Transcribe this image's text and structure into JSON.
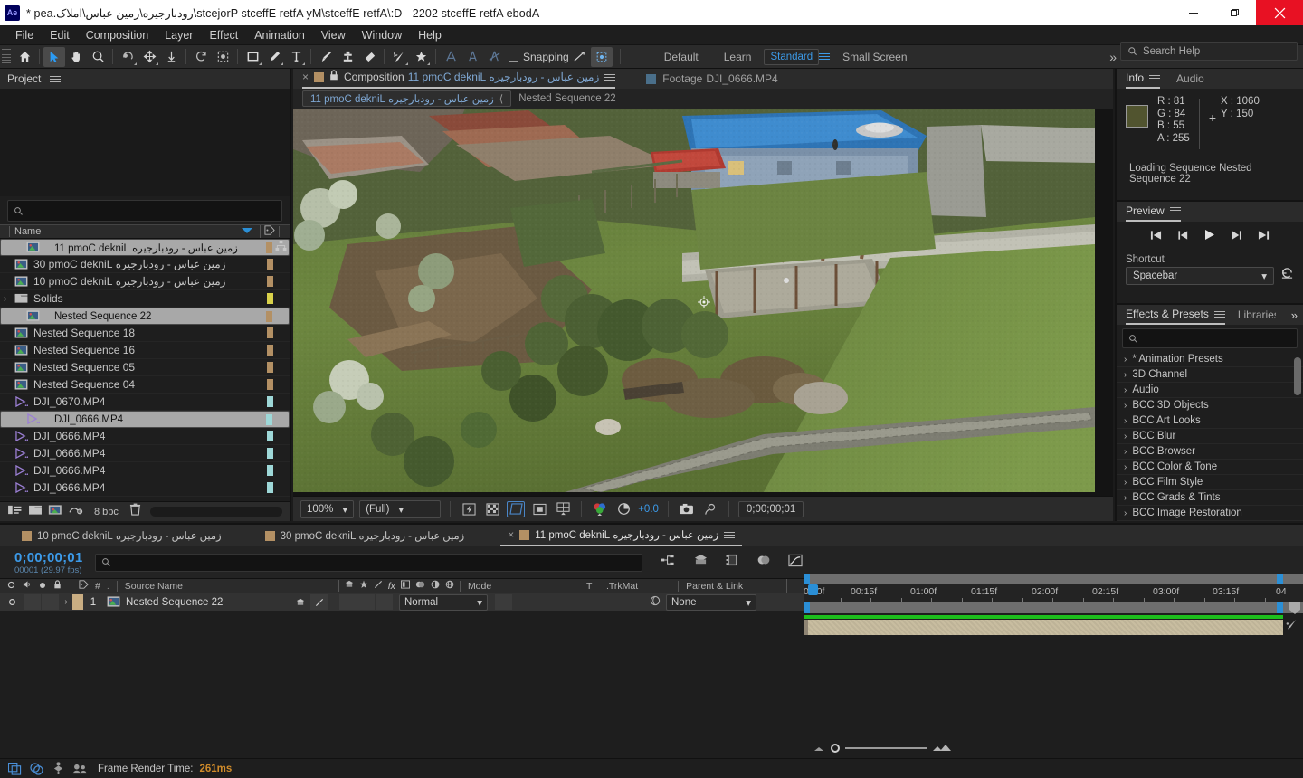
{
  "window": {
    "title": "Adobe After Effects 2022 - D:\\After Effects\\My After Effects Projects\\رودبارجیره\\زمین عباس\\املاک.aep *",
    "logo": "Ae",
    "minimize": "minimize-icon",
    "maximize": "maximize-icon",
    "close": "close-icon"
  },
  "menubar": {
    "items": [
      "File",
      "Edit",
      "Composition",
      "Layer",
      "Effect",
      "Animation",
      "View",
      "Window",
      "Help"
    ]
  },
  "toolbar": {
    "tools": [
      "home-icon",
      "selection-icon",
      "hand-icon",
      "zoom-icon",
      "rotation-icon",
      "unified-camera-icon",
      "pan-behind-icon",
      "rotate-shape-icon",
      "mask-icon",
      "rectangle-icon",
      "pen-icon",
      "type-icon",
      "brush-icon",
      "clone-stamp-icon",
      "eraser-icon",
      "roto-brush-icon",
      "puppet-pin-icon"
    ],
    "snapping_label": "Snapping",
    "workspaces": [
      "Default",
      "Learn",
      "Standard",
      "Small Screen"
    ],
    "selected_workspace": "Standard",
    "overflow": "»"
  },
  "search_help": {
    "placeholder": "Search Help",
    "icon": "search-icon"
  },
  "project": {
    "tab": "Project",
    "search_placeholder": "",
    "column_header": "Name",
    "items": [
      {
        "name": "زمین عباس - رودبارجیره Linked Comp 11",
        "type": "comp",
        "selected": true,
        "tag": "#b39064",
        "rtl": true
      },
      {
        "name": "زمین عباس - رودبارجیره Linked Comp 03",
        "type": "comp",
        "selected": false,
        "tag": "#b39064",
        "rtl": true
      },
      {
        "name": "زمین عباس - رودبارجیره Linked Comp 01",
        "type": "comp",
        "selected": false,
        "tag": "#b39064",
        "rtl": true
      },
      {
        "name": "Solids",
        "type": "folder",
        "selected": false,
        "tag": "#d9d14a",
        "rtl": false
      },
      {
        "name": "Nested Sequence 22",
        "type": "comp",
        "selected": true,
        "tag": "#b39064",
        "rtl": false
      },
      {
        "name": "Nested Sequence 18",
        "type": "comp",
        "selected": false,
        "tag": "#b39064",
        "rtl": false
      },
      {
        "name": "Nested Sequence 16",
        "type": "comp",
        "selected": false,
        "tag": "#b39064",
        "rtl": false
      },
      {
        "name": "Nested Sequence 05",
        "type": "comp",
        "selected": false,
        "tag": "#b39064",
        "rtl": false
      },
      {
        "name": "Nested Sequence 04",
        "type": "comp",
        "selected": false,
        "tag": "#b39064",
        "rtl": false
      },
      {
        "name": "DJI_0670.MP4",
        "type": "video",
        "selected": false,
        "tag": "#9ed8d8",
        "rtl": false
      },
      {
        "name": "DJI_0666.MP4",
        "type": "video",
        "selected": true,
        "tag": "#9ed8d8",
        "rtl": false
      },
      {
        "name": "DJI_0666.MP4",
        "type": "video",
        "selected": false,
        "tag": "#9ed8d8",
        "rtl": false
      },
      {
        "name": "DJI_0666.MP4",
        "type": "video",
        "selected": false,
        "tag": "#9ed8d8",
        "rtl": false
      },
      {
        "name": "DJI_0666.MP4",
        "type": "video",
        "selected": false,
        "tag": "#9ed8d8",
        "rtl": false
      },
      {
        "name": "DJI_0666.MP4",
        "type": "video",
        "selected": false,
        "tag": "#9ed8d8",
        "rtl": false
      }
    ],
    "footer": {
      "bit_depth": "8 bpc",
      "interpret_icon": "interpret-footage-icon",
      "folder_icon": "new-folder-icon",
      "comp_icon": "new-comp-icon",
      "delete_icon": "trash-icon"
    }
  },
  "comp_panel": {
    "tab_label_prefix": "Composition",
    "tab_name": "زمین عباس - رودبارجیره Linked Comp 11",
    "footage_tab_prefix": "Footage",
    "footage_tab_name": "DJI_0666.MP4",
    "breadcrumb_current": "زمین عباس - رودبارجیره Linked Comp 11",
    "breadcrumb_next": "Nested Sequence 22",
    "lock_icon": "lock-icon",
    "close_icon": "close-icon",
    "bottom": {
      "zoom": "100%",
      "resolution": "(Full)",
      "timecode": "0;00;00;01",
      "exposure": "+0.0",
      "buttons": [
        "fast-preview-icon",
        "transparency-grid-icon",
        "region-of-interest-icon",
        "mask-shape-icon",
        "proportional-grid-icon",
        "channel-icon",
        "exposure-icon",
        "snapshot-icon",
        "show-snapshot-icon"
      ]
    }
  },
  "info_panel": {
    "tabs": [
      "Info",
      "Audio"
    ],
    "active_tab": "Info",
    "R": "R : 81",
    "G": "G : 84",
    "B": "B : 55",
    "A": "A : 255",
    "X": "X : 1060",
    "Y": "Y : 150",
    "swatch_color": "#51542f",
    "message": "Loading Sequence Nested Sequence 22"
  },
  "preview_panel": {
    "tab": "Preview",
    "transport": [
      "first-frame-icon",
      "previous-frame-icon",
      "play-icon",
      "next-frame-icon",
      "last-frame-icon"
    ],
    "shortcut_label": "Shortcut",
    "shortcut_value": "Spacebar",
    "reset_icon": "reset-icon"
  },
  "effects_panel": {
    "tabs": [
      "Effects & Presets",
      "Libraries"
    ],
    "active_tab": "Effects & Presets",
    "search_placeholder": "",
    "categories": [
      "* Animation Presets",
      "3D Channel",
      "Audio",
      "BCC 3D Objects",
      "BCC Art Looks",
      "BCC Blur",
      "BCC Browser",
      "BCC Color & Tone",
      "BCC Film Style",
      "BCC Grads & Tints",
      "BCC Image Restoration"
    ]
  },
  "timeline": {
    "tabs": [
      {
        "label": "زمین عباس - رودبارجیره Linked Comp 01",
        "active": false,
        "color": "#b39064"
      },
      {
        "label": "زمین عباس - رودبارجیره Linked Comp 03",
        "active": false,
        "color": "#b39064"
      },
      {
        "label": "زمین عباس - رودبارجیره Linked Comp 11",
        "active": true,
        "color": "#b39064"
      }
    ],
    "current_time": "0;00;00;01",
    "frame_info": "00001 (29.97 fps)",
    "search_placeholder": "",
    "tool_icons": [
      "composition-mini-flowchart-icon",
      "draft-3d-icon",
      "hide-shy-layers-icon",
      "frame-blending-icon",
      "motion-blur-icon",
      "graph-editor-icon"
    ],
    "columns": [
      "Source Name",
      "Mode",
      "T",
      "TrkMat",
      "Parent & Link"
    ],
    "column_icons": [
      "video-toggle-icon",
      "audio-toggle-icon",
      "solo-icon",
      "lock-icon",
      "label-icon",
      "number-icon"
    ],
    "layers": [
      {
        "index": "1",
        "name": "Nested Sequence 22",
        "mode": "Normal",
        "trkmat": "",
        "parent": "None",
        "color": "#c9ad82"
      }
    ],
    "ruler_ticks": [
      "0:00f",
      "00:15f",
      "01:00f",
      "01:15f",
      "02:00f",
      "02:15f",
      "03:00f",
      "03:15f",
      "04"
    ]
  },
  "statusbar": {
    "icons": [
      "sync-settings-icon",
      "cc-libraries-icon",
      "puppet-icon",
      "team-projects-icon"
    ],
    "label": "Frame Render Time:",
    "value": "261ms"
  }
}
